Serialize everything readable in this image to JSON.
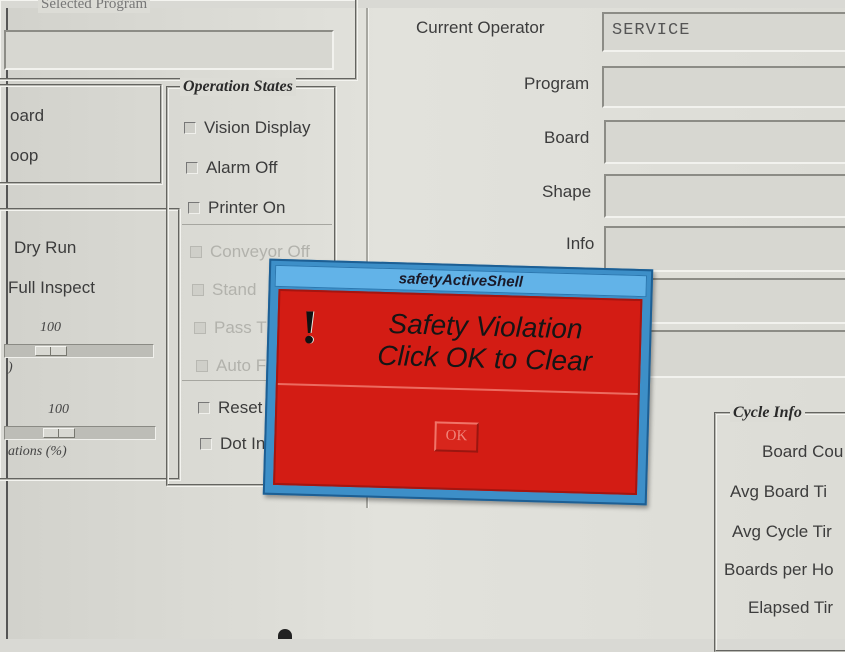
{
  "program_frame": {
    "legend": "Selected Program",
    "value": ""
  },
  "left_group": {
    "items": [
      "oard",
      "oop"
    ]
  },
  "run_group": {
    "items": [
      "Dry Run",
      "Full Inspect"
    ],
    "slider1": {
      "max_label": "100",
      "caption": ")"
    },
    "slider2": {
      "max_label": "100",
      "caption": "ations (%)"
    }
  },
  "operation_states": {
    "legend": "Operation States",
    "items": [
      {
        "label": "Vision Display",
        "enabled": true
      },
      {
        "label": "Alarm Off",
        "enabled": true
      },
      {
        "label": "Printer On",
        "enabled": true
      },
      {
        "label": "Conveyor Off",
        "enabled": false
      },
      {
        "label": "Stand",
        "enabled": false
      },
      {
        "label": "Pass T",
        "enabled": false
      },
      {
        "label": "Auto F",
        "enabled": false
      },
      {
        "label": "Reset",
        "enabled": true
      },
      {
        "label": "Dot In",
        "enabled": true
      }
    ]
  },
  "info_panel": {
    "current_operator_label": "Current Operator",
    "current_operator_value": "SERVICE",
    "fields": [
      {
        "label": "Program",
        "value": ""
      },
      {
        "label": "Board",
        "value": ""
      },
      {
        "label": "Shape",
        "value": ""
      },
      {
        "label": "Info",
        "value": ""
      }
    ]
  },
  "cycle_info": {
    "legend": "Cycle Info",
    "items": [
      "Board Cou",
      "Avg Board Ti",
      "Avg Cycle Tir",
      "Boards per Ho",
      "Elapsed Tir"
    ]
  },
  "dialog": {
    "title": "safetyActiveShell",
    "icon": "!",
    "message_line1": "Safety Violation",
    "message_line2": "Click OK to Clear",
    "ok_label": "OK"
  },
  "colors": {
    "dialog_bg": "#d31c14",
    "dialog_frame": "#3d8fc8",
    "screen_bg": "#dcdcd6"
  }
}
